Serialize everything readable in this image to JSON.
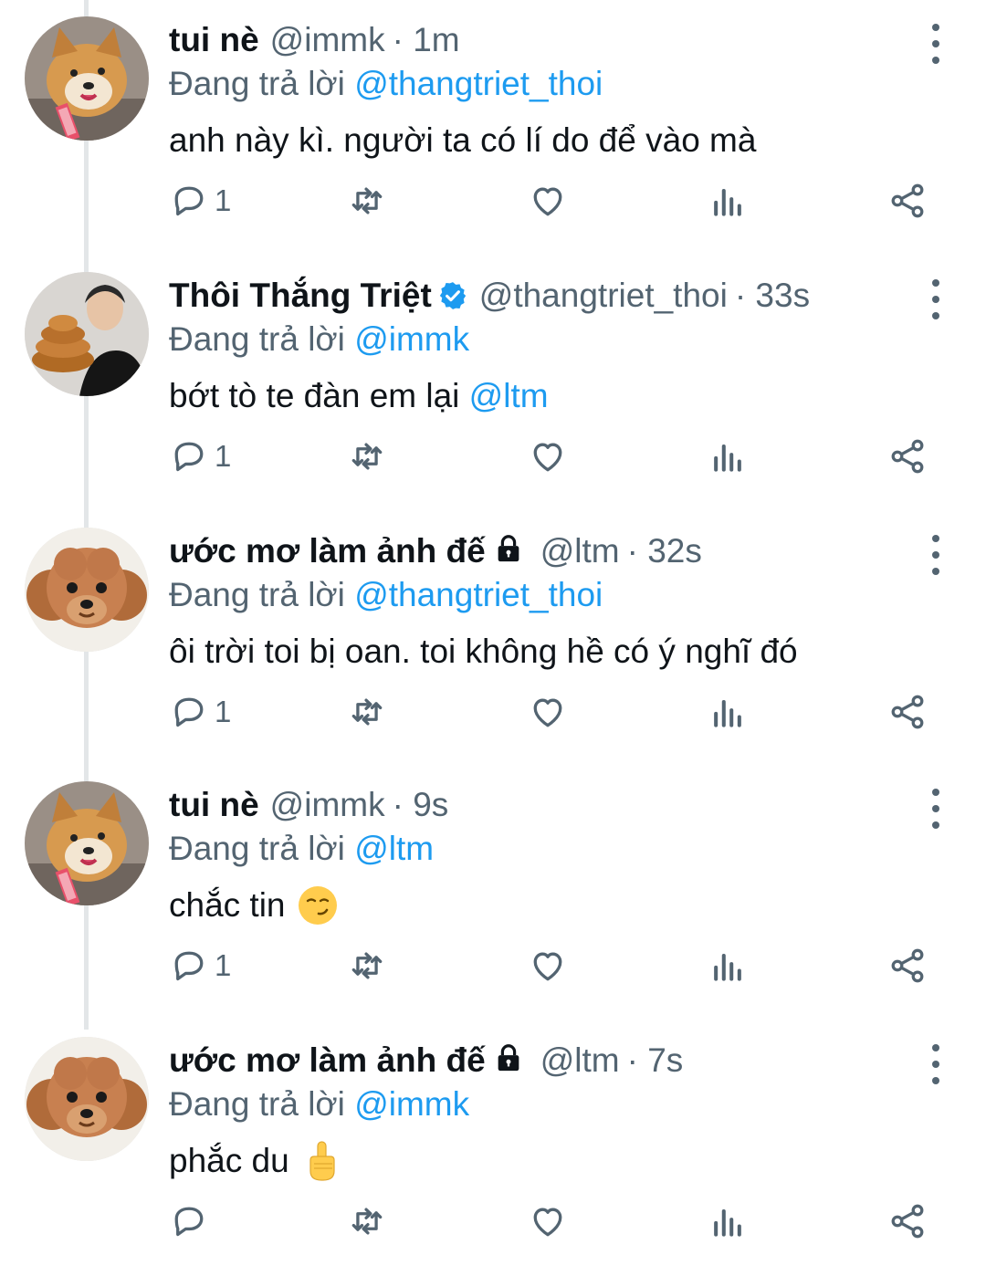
{
  "colors": {
    "accent": "#1d9bf0",
    "muted": "#536471",
    "text": "#0f1419",
    "verified": "#1d9bf0"
  },
  "reply_prefix": "Đang trả lời",
  "tweets": [
    {
      "avatar": "shiba-dog-avatar",
      "name": "tui nè",
      "verified": false,
      "locked": false,
      "handle": "@immk",
      "time": "· 1m",
      "reply_to": "@thangtriet_thoi",
      "text": "anh này kì. người ta có lí do để vào mà",
      "mention": "",
      "emoji": "",
      "reply_count": "1"
    },
    {
      "avatar": "person-with-bread-avatar",
      "name": "Thôi Thắng Triệt",
      "verified": true,
      "locked": false,
      "handle": "@thangtriet_thoi",
      "time": "· 33s",
      "reply_to": "@immk",
      "text": "bớt tò te đàn em lại ",
      "mention": "@ltm",
      "emoji": "",
      "reply_count": "1"
    },
    {
      "avatar": "poodle-dog-avatar",
      "name": "ước mơ làm ảnh đế",
      "verified": false,
      "locked": true,
      "handle": "@ltm",
      "time": "· 32s",
      "reply_to": "@thangtriet_thoi",
      "text": "ôi trời toi bị oan. toi không hề có ý nghĩ đó",
      "mention": "",
      "emoji": "",
      "reply_count": "1"
    },
    {
      "avatar": "shiba-dog-avatar",
      "name": "tui nè",
      "verified": false,
      "locked": false,
      "handle": "@immk",
      "time": "· 9s",
      "reply_to": "@ltm",
      "text": "chắc tin",
      "mention": "",
      "emoji": "smirking-face-emoji",
      "reply_count": "1"
    },
    {
      "avatar": "poodle-dog-avatar",
      "name": "ước mơ làm ảnh đế",
      "verified": false,
      "locked": true,
      "handle": "@ltm",
      "time": "· 7s",
      "reply_to": "@immk",
      "text": "phắc du",
      "mention": "",
      "emoji": "pointing-up-hand-emoji",
      "reply_count": ""
    }
  ]
}
